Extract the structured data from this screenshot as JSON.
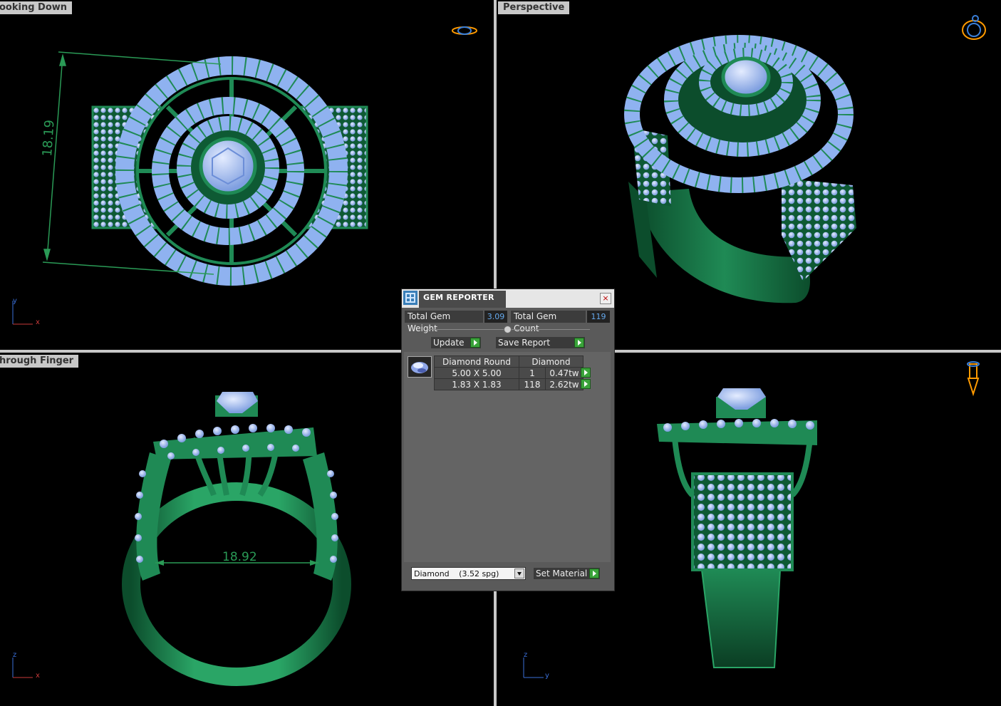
{
  "viewports": {
    "top_left": {
      "label": "ooking Down",
      "dimension": "18.19",
      "axis_v": "y",
      "axis_h": "x"
    },
    "top_right": {
      "label": "Perspective"
    },
    "bottom_left": {
      "label": "hrough Finger",
      "dimension": "18.92",
      "axis_v": "z",
      "axis_h": "x"
    },
    "bottom_right": {
      "axis_v": "z",
      "axis_h": "y"
    }
  },
  "gem_reporter": {
    "title": "GEM REPORTER",
    "close": "×",
    "total_weight_label": "Total Gem Weight",
    "total_weight_value": "3.09",
    "total_count_label": "Total Gem Count",
    "total_count_value": "119",
    "update_label": "Update",
    "save_report_label": "Save Report",
    "table_headers": [
      "Diamond Round",
      "Diamond"
    ],
    "rows": [
      {
        "size": "5.00 X 5.00",
        "count": "1",
        "weight": "0.47tw"
      },
      {
        "size": "1.83 X 1.83",
        "count": "118",
        "weight": "2.62tw"
      }
    ],
    "material_name": "Diamond",
    "material_spg": "(3.52 spg)",
    "set_material_label": "Set Material"
  },
  "colors": {
    "metal": "#1f8a55",
    "metal_dark": "#0c4d2c",
    "gem": "#8fb2f0",
    "gem_light": "#c9daff",
    "dimension": "#2a9a56",
    "value_text": "#66aaee"
  }
}
